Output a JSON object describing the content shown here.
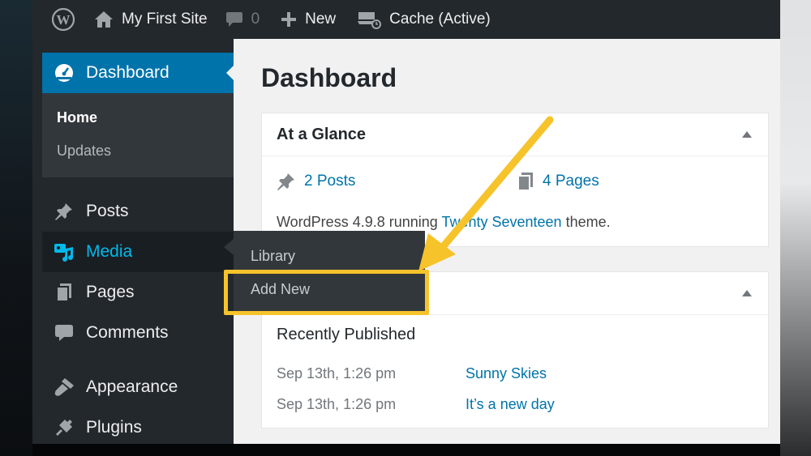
{
  "admin_bar": {
    "site_name": "My First Site",
    "comments_count": "0",
    "new_label": "New",
    "cache_label": "Cache (Active)"
  },
  "sidebar": {
    "dashboard_label": "Dashboard",
    "submenu": [
      {
        "label": "Home",
        "current": true
      },
      {
        "label": "Updates"
      }
    ],
    "items": [
      {
        "label": "Posts",
        "icon": "pin-icon"
      },
      {
        "label": "Media",
        "icon": "media-icon",
        "active": true
      },
      {
        "label": "Pages",
        "icon": "pages-icon"
      },
      {
        "label": "Comments",
        "icon": "comment-icon"
      },
      {
        "label": "Appearance",
        "icon": "brush-icon"
      },
      {
        "label": "Plugins",
        "icon": "plugin-icon"
      }
    ]
  },
  "flyout": {
    "items": [
      "Library",
      "Add New"
    ],
    "highlighted": "Add New"
  },
  "main": {
    "page_title": "Dashboard",
    "glance": {
      "title": "At a Glance",
      "posts": "2 Posts",
      "pages": "4 Pages",
      "wp_text_before": "WordPress 4.9.8 running ",
      "theme_link": "Twenty Seventeen",
      "wp_text_after": " theme."
    },
    "activity": {
      "recent_title": "Recently Published",
      "rows": [
        {
          "date": "Sep 13th, 1:26 pm",
          "post": "Sunny Skies"
        },
        {
          "date": "Sep 13th, 1:26 pm",
          "post": "It’s a new day"
        }
      ]
    }
  },
  "colors": {
    "admin_bg": "#23282d",
    "accent": "#0073aa",
    "media_active": "#00b9eb",
    "annotation": "#f6c32b"
  }
}
